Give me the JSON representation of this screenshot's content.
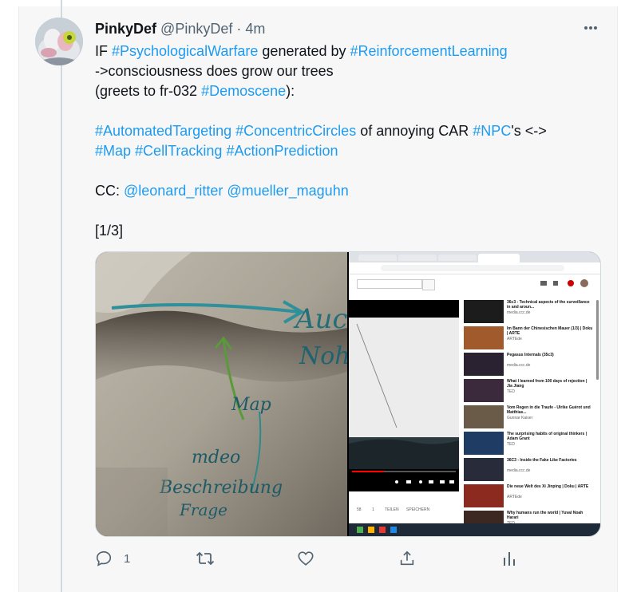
{
  "tweet": {
    "author_name": "PinkyDef",
    "handle": "@PinkyDef",
    "separator": "·",
    "time": "4m",
    "more_icon": "more-horizontal-icon",
    "avatar_alt": "avatar"
  },
  "body": {
    "line1": [
      {
        "t": "IF ",
        "tag": false
      },
      {
        "t": "#PsychologicalWarfare",
        "tag": true
      },
      {
        "t": " generated by ",
        "tag": false
      },
      {
        "t": "#ReinforcementLearning",
        "tag": true
      }
    ],
    "line2": [
      {
        "t": "->consciousness does grow our trees",
        "tag": false
      }
    ],
    "line3": [
      {
        "t": "(greets to fr-032  ",
        "tag": false
      },
      {
        "t": "#Demoscene",
        "tag": true
      },
      {
        "t": "):",
        "tag": false
      }
    ],
    "line4": [
      {
        "t": "#AutomatedTargeting",
        "tag": true
      },
      {
        "t": " ",
        "tag": false
      },
      {
        "t": "#ConcentricCircles",
        "tag": true
      },
      {
        "t": " of annoying CAR ",
        "tag": false
      },
      {
        "t": "#NPC",
        "tag": true
      },
      {
        "t": "'s <->",
        "tag": false
      }
    ],
    "line5": [
      {
        "t": "#Map",
        "tag": true
      },
      {
        "t": " ",
        "tag": false
      },
      {
        "t": "#CellTracking",
        "tag": true
      },
      {
        "t": " ",
        "tag": false
      },
      {
        "t": "#ActionPrediction",
        "tag": true
      }
    ],
    "line6": [
      {
        "t": "CC: ",
        "tag": false
      },
      {
        "t": "@leonard_ritter",
        "tag": true
      },
      {
        "t": " ",
        "tag": false
      },
      {
        "t": "@mueller_maguhn",
        "tag": true
      }
    ],
    "line7": [
      {
        "t": "[1/3]",
        "tag": false
      }
    ]
  },
  "media": {
    "left_handwriting": [
      "Auc",
      "Noh",
      "Map",
      "mdeo",
      "Beschreibung",
      "Frage"
    ],
    "browser": {
      "video_list": [
        {
          "title": "36c3 - Technical aspects of the surveillance in and aroun...",
          "channel": "media.ccc.de",
          "thumb": "#1c1c1c"
        },
        {
          "title": "Im Bann der Chinesischen Mauer (1/3) | Doku | ARTE",
          "channel": "ARTEde",
          "thumb": "#a05a2c"
        },
        {
          "title": "Pegasus Internals (35c3)",
          "channel": "media.ccc.de",
          "thumb": "#2a2230"
        },
        {
          "title": "What I learned from 100 days of rejection | Jia Jiang",
          "channel": "TED",
          "thumb": "#3a2a3c"
        },
        {
          "title": "Vom Regen in die Traufe - Ulrike Guérot und Matthias...",
          "channel": "Gunnar Kaiser",
          "thumb": "#6a5a48"
        },
        {
          "title": "The surprising habits of original thinkers | Adam Grant",
          "channel": "TED",
          "thumb": "#1e3c64"
        },
        {
          "title": "36C3 - Inside the Fake Like Factories",
          "channel": "media.ccc.de",
          "thumb": "#282c3a"
        },
        {
          "title": "Die neue Welt des Xi Jinping | Doku | ARTE",
          "channel": "ARTEde",
          "thumb": "#8c2a20"
        },
        {
          "title": "Why humans run the world | Yuval Noah Harari",
          "channel": "TED",
          "thumb": "#3c2820"
        }
      ],
      "player_controls": [
        "TEILEN",
        "SPEICHERN"
      ],
      "likes": "58",
      "dislikes": "1"
    }
  },
  "actions": {
    "reply_count": "1",
    "retweet_count": "",
    "like_count": "",
    "share_count": ""
  }
}
